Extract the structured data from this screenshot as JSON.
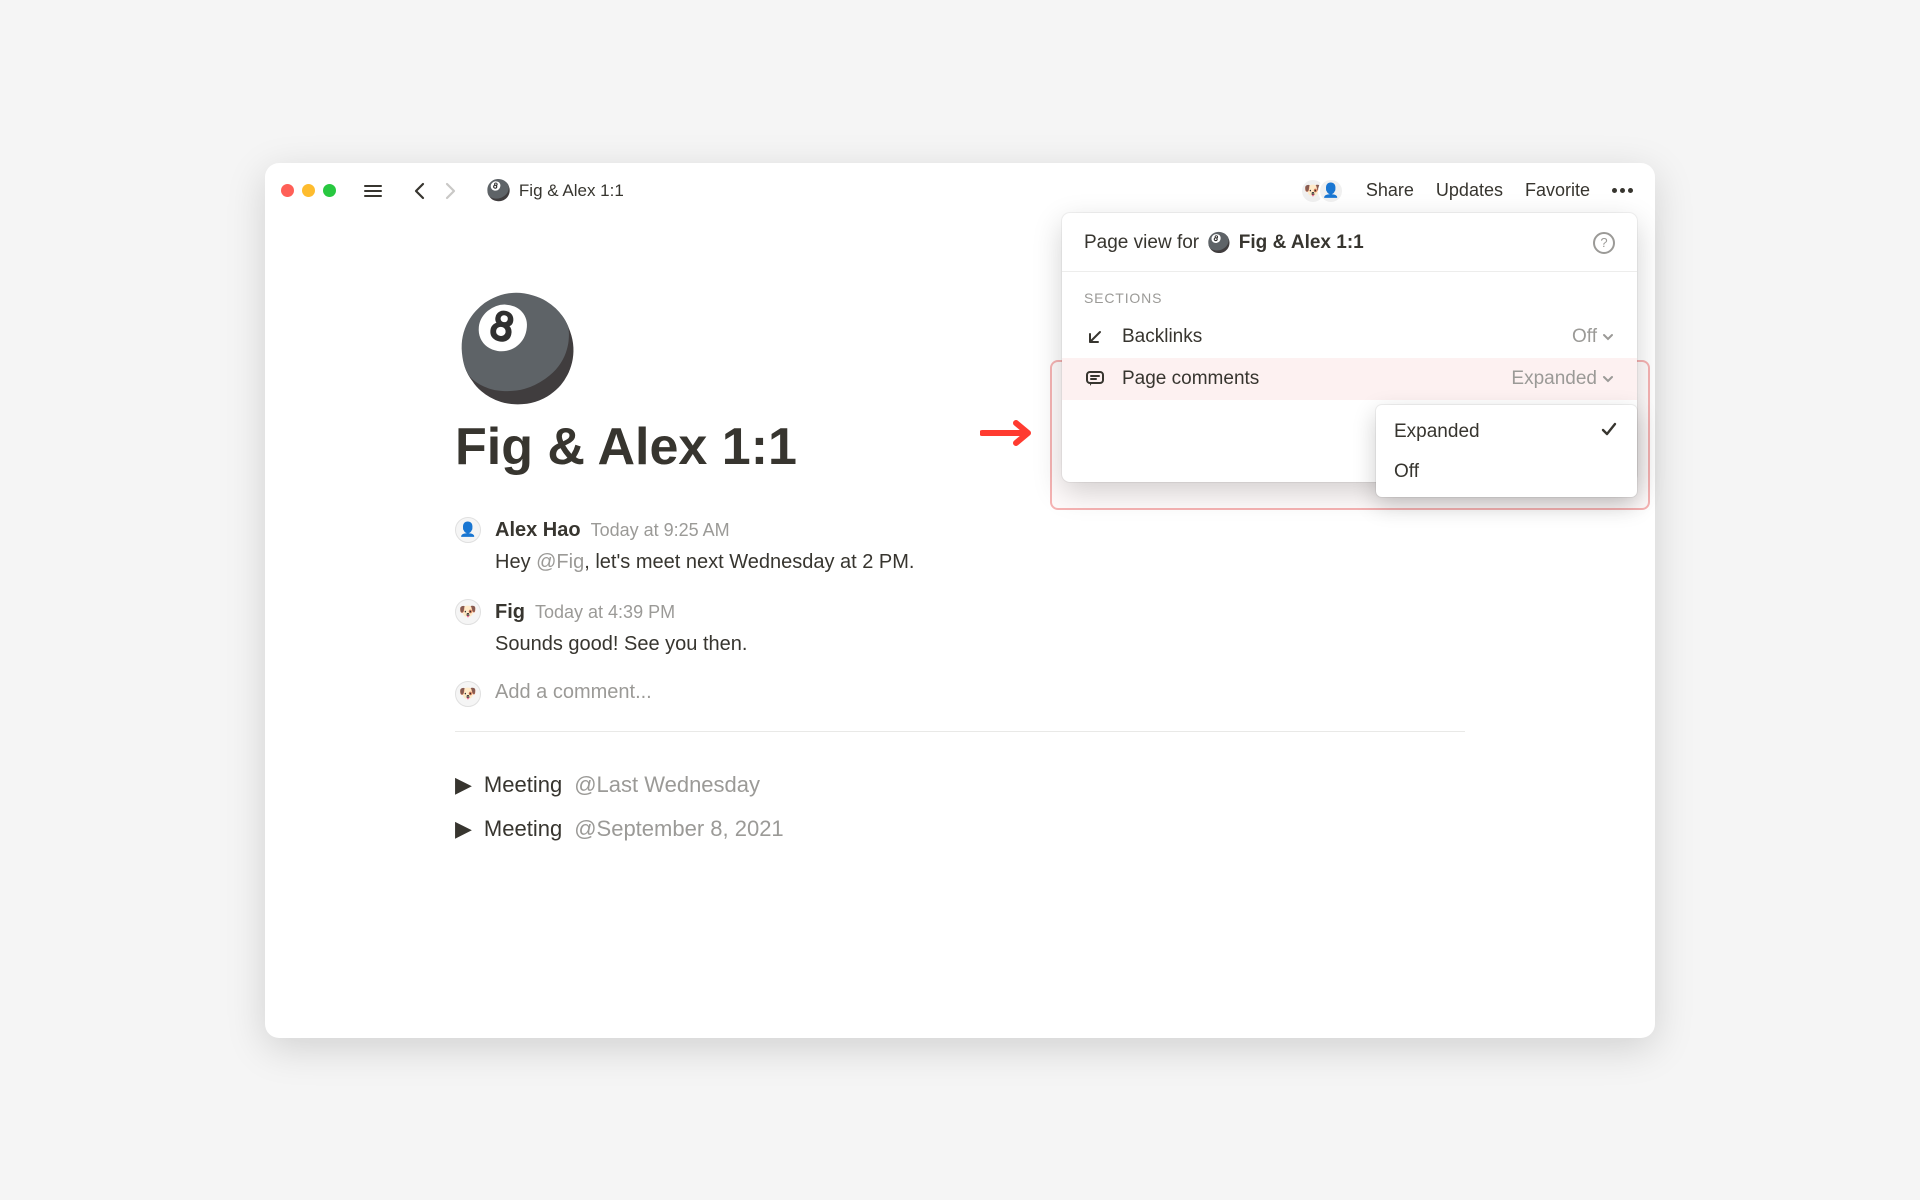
{
  "breadcrumb": {
    "icon": "🎱",
    "title": "Fig & Alex 1:1"
  },
  "topbar": {
    "share": "Share",
    "updates": "Updates",
    "favorite": "Favorite"
  },
  "page": {
    "icon": "🎱",
    "title": "Fig & Alex 1:1"
  },
  "comments": [
    {
      "author": "Alex Hao",
      "time": "Today at 9:25 AM",
      "text_pre": "Hey ",
      "mention": "@Fig",
      "text_post": ", let's meet next Wednesday at 2 PM.",
      "avatar": "👤"
    },
    {
      "author": "Fig",
      "time": "Today at 4:39 PM",
      "text_pre": "Sounds good! See you then.",
      "mention": "",
      "text_post": "",
      "avatar": "🐶"
    }
  ],
  "add_comment": {
    "placeholder": "Add a comment...",
    "avatar": "🐶"
  },
  "toggles": [
    {
      "label": "Meeting",
      "ref": "@Last Wednesday"
    },
    {
      "label": "Meeting",
      "ref": "@September 8, 2021"
    }
  ],
  "popover": {
    "prefix": "Page view for",
    "icon": "🎱",
    "page_name": "Fig & Alex 1:1",
    "sections_title": "SECTIONS",
    "rows": {
      "backlinks": {
        "label": "Backlinks",
        "value": "Off"
      },
      "page_comments": {
        "label": "Page comments",
        "value": "Expanded"
      }
    }
  },
  "dropdown": {
    "expanded": "Expanded",
    "off": "Off"
  }
}
